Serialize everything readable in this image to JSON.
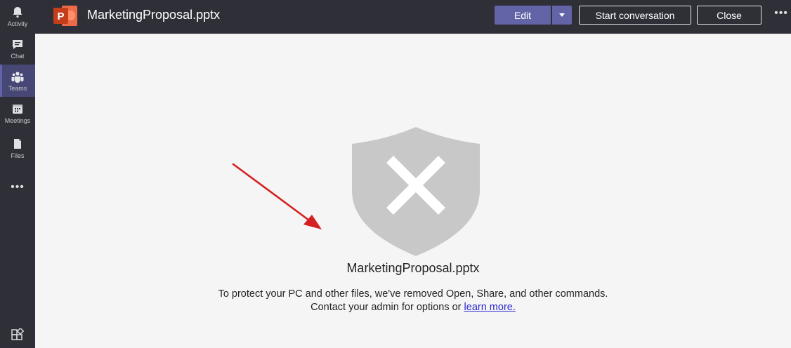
{
  "rail": {
    "items": [
      {
        "label": "Activity",
        "icon": "bell-icon"
      },
      {
        "label": "Chat",
        "icon": "chat-icon"
      },
      {
        "label": "Teams",
        "icon": "teams-icon",
        "active": true
      },
      {
        "label": "Meetings",
        "icon": "calendar-icon"
      },
      {
        "label": "Files",
        "icon": "file-icon"
      }
    ],
    "more": "•••"
  },
  "header": {
    "app_icon_letter": "P",
    "file_title": "MarketingProposal.pptx",
    "edit_label": "Edit",
    "start_label": "Start conversation",
    "close_label": "Close",
    "more": "•••"
  },
  "main": {
    "doc_name": "MarketingProposal.pptx",
    "message_line1": "To protect your PC and other files, we've removed Open, Share, and other commands.",
    "message_line2_prefix": "Contact your admin for options or ",
    "learn_more": "learn more."
  },
  "colors": {
    "rail_bg": "#2f2f38",
    "accent": "#6264a7",
    "ppt_orange": "#d35230",
    "shield_gray": "#c8c8c8",
    "arrow_red": "#d42020"
  }
}
